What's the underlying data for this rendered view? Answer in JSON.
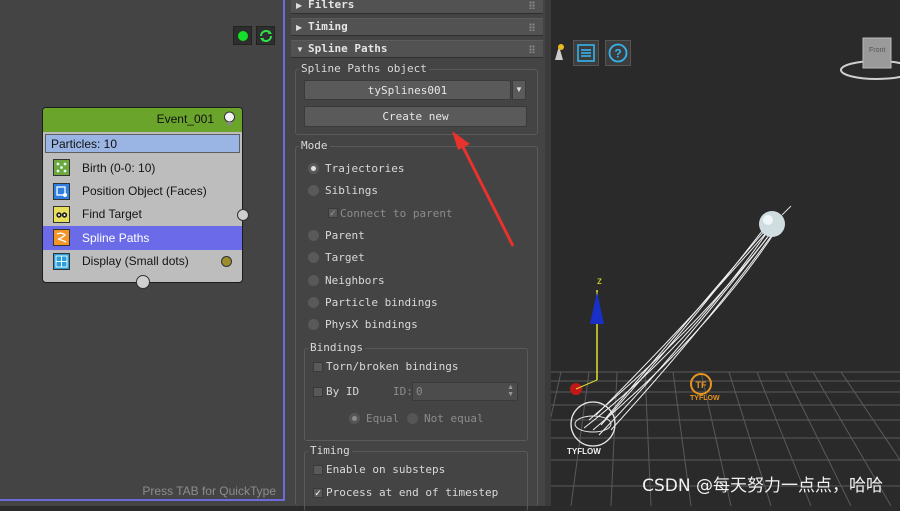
{
  "particle_view": {
    "event": {
      "title": "Event_001",
      "count": "Particles: 10",
      "operators": [
        {
          "label": "Birth (0-0: 10)",
          "icon": "birth-grid-icon"
        },
        {
          "label": "Position Object (Faces)",
          "icon": "position-object-icon"
        },
        {
          "label": "Find Target",
          "icon": "find-target-icon"
        },
        {
          "label": "Spline Paths",
          "icon": "spline-paths-icon",
          "selected": true
        },
        {
          "label": "Display (Small dots)",
          "icon": "display-icon"
        }
      ]
    },
    "hint": "Press TAB for QuickType"
  },
  "rollouts": {
    "filters": "Filters",
    "timing_top": "Timing",
    "spline_paths": "Spline Paths"
  },
  "spline_paths": {
    "object_group": "Spline Paths object",
    "object_value": "tySplines001",
    "create_new": "Create new",
    "mode_label": "Mode",
    "mode_options": [
      "Trajectories",
      "Siblings",
      "Parent",
      "Target",
      "Neighbors",
      "Particle bindings",
      "PhysX bindings"
    ],
    "connect_to_parent": "Connect to parent",
    "bindings_label": "Bindings",
    "torn_broken": "Torn/broken bindings",
    "by_id": "By ID",
    "id_label": "ID:",
    "id_value": "0",
    "equal": "Equal",
    "not_equal": "Not equal",
    "timing_label": "Timing",
    "enable_substeps": "Enable on substeps",
    "process_end": "Process at end of timestep"
  },
  "viewport": {
    "axis_z": "z",
    "logo_text": "TYFLOW",
    "nav_cube_label": "Front"
  },
  "watermark": "CSDN @每天努力一点点，哈哈",
  "colors": {
    "event_header": "#6aa42a",
    "selected_row": "#6b6bea",
    "frame": "#6e6ad8",
    "arrow": "#e8322b"
  }
}
